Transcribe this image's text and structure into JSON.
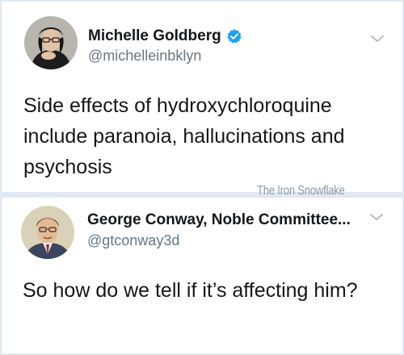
{
  "tweets": [
    {
      "display_name": "Michelle Goldberg",
      "handle": "@michelleinbklyn",
      "verified": true,
      "avatar_icon": "profile-photo-woman",
      "text": "Side effects of hydroxychloroquine include paranoia,  hallucinations and psychosis"
    },
    {
      "display_name": "George Conway, Noble Committee...",
      "handle": "@gtconway3d",
      "verified": false,
      "avatar_icon": "profile-illustration-man",
      "text": "So how do we tell if it’s affecting him?"
    }
  ],
  "watermark": "The Iron Snowflake",
  "colors": {
    "verified_blue": "#1da1f2",
    "text": "#14171a",
    "handle_gray": "#657786",
    "background": "#dfe8f2"
  }
}
